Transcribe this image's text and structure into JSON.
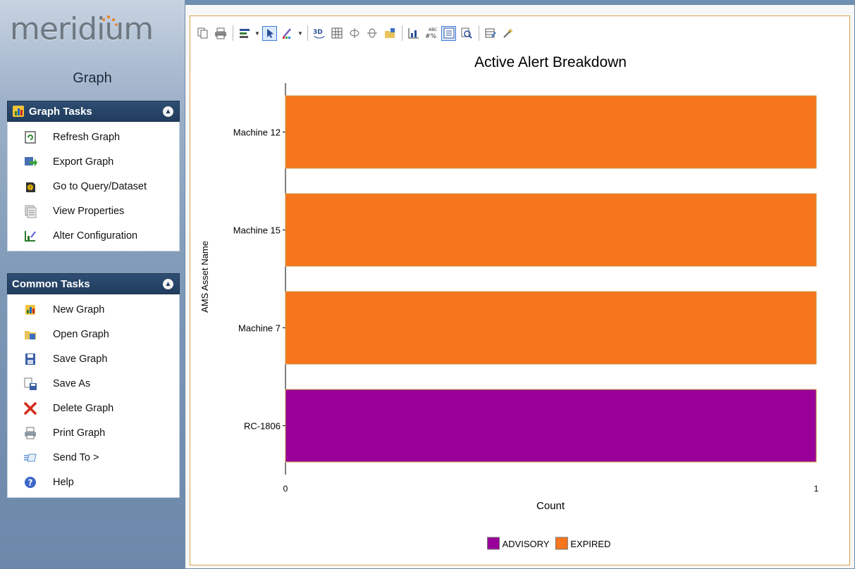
{
  "app": {
    "logo_text": "meridium",
    "page_title": "Graph"
  },
  "sidebar": {
    "graph_tasks": {
      "title": "Graph Tasks",
      "items": [
        {
          "label": "Refresh Graph",
          "icon": "refresh-icon"
        },
        {
          "label": "Export Graph",
          "icon": "export-icon"
        },
        {
          "label": "Go to Query/Dataset",
          "icon": "query-icon"
        },
        {
          "label": "View Properties",
          "icon": "properties-icon"
        },
        {
          "label": "Alter Configuration",
          "icon": "configuration-icon"
        }
      ]
    },
    "common_tasks": {
      "title": "Common Tasks",
      "items": [
        {
          "label": "New Graph",
          "icon": "new-graph-icon"
        },
        {
          "label": "Open Graph",
          "icon": "open-folder-icon"
        },
        {
          "label": "Save Graph",
          "icon": "save-icon"
        },
        {
          "label": "Save As",
          "icon": "save-as-icon"
        },
        {
          "label": "Delete Graph",
          "icon": "delete-icon"
        },
        {
          "label": "Print Graph",
          "icon": "print-icon"
        },
        {
          "label": "Send To >",
          "icon": "send-to-icon"
        },
        {
          "label": "Help",
          "icon": "help-icon"
        }
      ]
    }
  },
  "toolbar": {
    "buttons": [
      "copy-icon",
      "print-icon",
      "gallery-icon",
      "pointer-icon",
      "color-palette-icon",
      "3d-icon",
      "grid-icon",
      "rotate-horizontal-icon",
      "rotate-vertical-icon",
      "export-chart-icon",
      "axis-settings-icon",
      "data-labels-icon",
      "legend-icon",
      "zoom-icon",
      "data-editor-icon",
      "tools-icon"
    ]
  },
  "colors": {
    "advisory": "#990099",
    "expired": "#f7751d",
    "bar_border": "#cc9944"
  },
  "chart_data": {
    "type": "bar",
    "orientation": "horizontal",
    "title": "Active Alert Breakdown",
    "xlabel": "Count",
    "ylabel": "AMS Asset Name",
    "categories": [
      "Machine 12",
      "Machine 15",
      "Machine 7",
      "RC-1806"
    ],
    "series": [
      {
        "name": "ADVISORY",
        "color": "#990099",
        "values": [
          0,
          0,
          0,
          1
        ]
      },
      {
        "name": "EXPIRED",
        "color": "#f7751d",
        "values": [
          1,
          1,
          1,
          0
        ]
      }
    ],
    "xlim": [
      0,
      1
    ],
    "xticks": [
      "0",
      "1"
    ],
    "stacked": true,
    "grid": false,
    "legend_position": "bottom-center"
  }
}
